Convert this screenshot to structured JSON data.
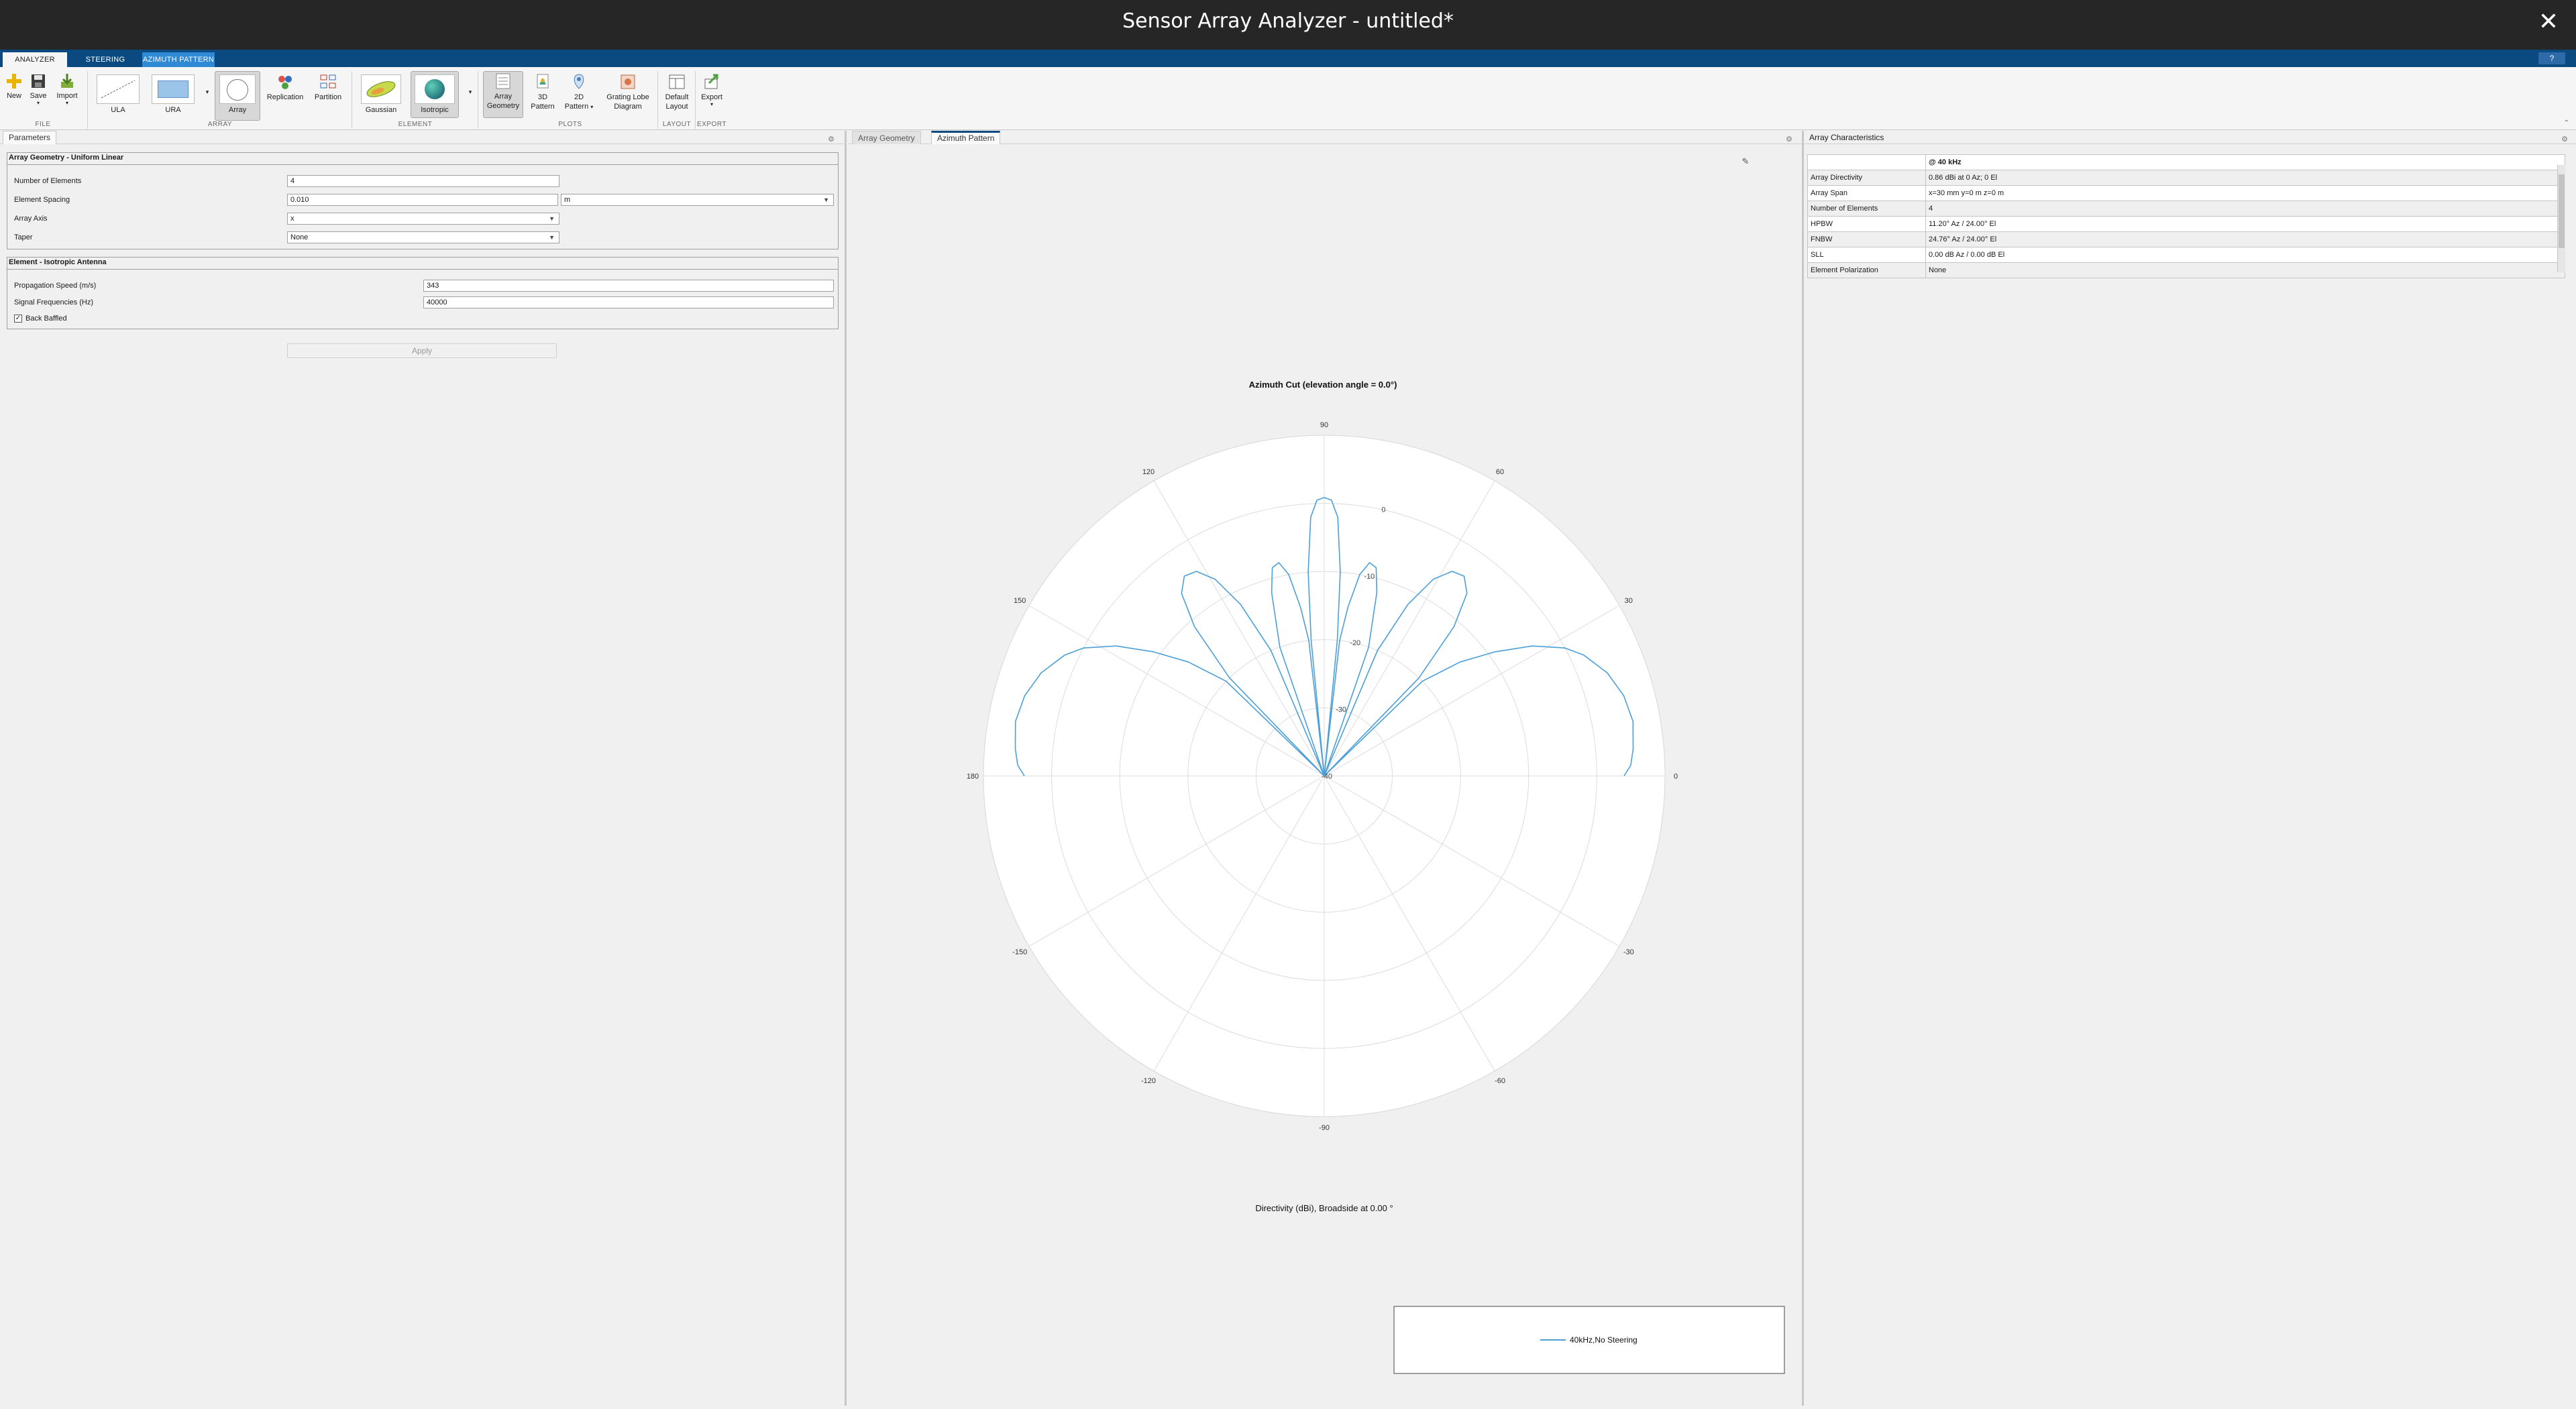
{
  "window": {
    "title": "Sensor Array Analyzer - untitled*",
    "close_glyph": "✕"
  },
  "ribbon_tabs": [
    {
      "label": "ANALYZER",
      "state": "active"
    },
    {
      "label": "STEERING",
      "state": "normal"
    },
    {
      "label": "AZIMUTH PATTERN",
      "state": "contextual"
    }
  ],
  "help_glyph": "?",
  "toolstrip": {
    "file": {
      "label": "FILE",
      "new": "New",
      "save": "Save",
      "import": "Import"
    },
    "array": {
      "label": "ARRAY",
      "ula": "ULA",
      "ura": "URA",
      "array": "Array",
      "replication": "Replication",
      "partition": "Partition"
    },
    "element": {
      "label": "ELEMENT",
      "gaussian": "Gaussian",
      "isotropic": "Isotropic"
    },
    "plots": {
      "label": "PLOTS",
      "array_geometry_1": "Array",
      "array_geometry_2": "Geometry",
      "pattern3d_1": "3D",
      "pattern3d_2": "Pattern",
      "pattern2d_1": "2D",
      "pattern2d_2": "Pattern",
      "grating_1": "Grating Lobe",
      "grating_2": "Diagram"
    },
    "layout": {
      "label": "LAYOUT",
      "default_1": "Default",
      "default_2": "Layout"
    },
    "export": {
      "label": "EXPORT",
      "export": "Export"
    }
  },
  "parameters": {
    "tab": "Parameters",
    "geometry": {
      "title": "Array Geometry - Uniform Linear",
      "num_elements_label": "Number of Elements",
      "num_elements": "4",
      "spacing_label": "Element Spacing",
      "spacing": "0.010",
      "spacing_unit": "m",
      "axis_label": "Array Axis",
      "axis": "x",
      "taper_label": "Taper",
      "taper": "None"
    },
    "element": {
      "title": "Element - Isotropic Antenna",
      "speed_label": "Propagation Speed (m/s)",
      "speed": "343",
      "freq_label": "Signal Frequencies (Hz)",
      "freq": "40000",
      "baffled_label": "Back Baffled",
      "baffled_checked": true
    },
    "apply": "Apply"
  },
  "plot_tabs": [
    "Array Geometry",
    "Azimuth Pattern"
  ],
  "chart_data": {
    "type": "polar-line",
    "title": "Azimuth Cut (elevation angle = 0.0°)",
    "subtitle": "Directivity (dBi), Broadside at 0.00 °",
    "angle_ticks": [
      "0",
      "30",
      "60",
      "90",
      "120",
      "150",
      "180",
      "-150",
      "-120",
      "-90",
      "-60",
      "-30"
    ],
    "radial_ticks": [
      "0",
      "-10",
      "-20",
      "-30",
      "-40"
    ],
    "rlim": [
      -40,
      0
    ],
    "legend": [
      "40kHz,No Steering"
    ],
    "series": [
      {
        "name": "40kHz,No Steering",
        "color": "#4c9fd8",
        "points": [
          [
            0,
            4
          ],
          [
            2,
            5
          ],
          [
            5,
            5.5
          ],
          [
            10,
            6
          ],
          [
            15,
            5.5
          ],
          [
            20,
            4.2
          ],
          [
            25,
            2.0
          ],
          [
            28,
            0
          ],
          [
            32,
            -4
          ],
          [
            36,
            -9
          ],
          [
            40,
            -14
          ],
          [
            44,
            -20
          ],
          [
            45,
            -40
          ],
          [
            46,
            -20
          ],
          [
            49,
            -11
          ],
          [
            52,
            -6
          ],
          [
            55,
            -4.2
          ],
          [
            58,
            -4.6
          ],
          [
            61,
            -7
          ],
          [
            64,
            -12
          ],
          [
            67,
            -20
          ],
          [
            69,
            -40
          ],
          [
            71,
            -20
          ],
          [
            74,
            -12
          ],
          [
            76,
            -8.5
          ],
          [
            78,
            -8
          ],
          [
            80,
            -10
          ],
          [
            82,
            -15
          ],
          [
            83.5,
            -20
          ],
          [
            84,
            -40
          ],
          [
            84.5,
            -20
          ],
          [
            85.5,
            -10
          ],
          [
            87,
            -2
          ],
          [
            88.5,
            0.5
          ],
          [
            90,
            0.86
          ],
          [
            91.5,
            0.5
          ],
          [
            93,
            -2
          ],
          [
            94.5,
            -10
          ],
          [
            95.5,
            -20
          ],
          [
            96,
            -40
          ],
          [
            96.5,
            -20
          ],
          [
            98,
            -15
          ],
          [
            100,
            -10
          ],
          [
            102,
            -8
          ],
          [
            104,
            -8.5
          ],
          [
            106,
            -12
          ],
          [
            109,
            -20
          ],
          [
            111,
            -40
          ],
          [
            113,
            -20
          ],
          [
            116,
            -12
          ],
          [
            119,
            -7
          ],
          [
            122,
            -4.6
          ],
          [
            125,
            -4.2
          ],
          [
            128,
            -6
          ],
          [
            131,
            -11
          ],
          [
            134,
            -20
          ],
          [
            135,
            -40
          ],
          [
            136,
            -20
          ],
          [
            140,
            -14
          ],
          [
            144,
            -9
          ],
          [
            148,
            -4
          ],
          [
            152,
            0
          ],
          [
            155,
            2.0
          ],
          [
            160,
            4.2
          ],
          [
            165,
            5.5
          ],
          [
            170,
            6
          ],
          [
            175,
            5.5
          ],
          [
            178,
            5
          ],
          [
            180,
            4
          ]
        ]
      }
    ]
  },
  "characteristics": {
    "title": "Array Characteristics",
    "column_header": "@ 40 kHz",
    "rows": [
      {
        "k": "Array Directivity",
        "v": "0.86 dBi at 0 Az; 0 El"
      },
      {
        "k": "Array Span",
        "v": "x=30 mm y=0 m z=0 m"
      },
      {
        "k": "Number of Elements",
        "v": "4"
      },
      {
        "k": "HPBW",
        "v": "11.20° Az / 24.00° El"
      },
      {
        "k": "FNBW",
        "v": "24.76° Az / 24.00° El"
      },
      {
        "k": "SLL",
        "v": "0.00 dB Az / 0.00 dB El"
      },
      {
        "k": "Element Polarization",
        "v": "None"
      }
    ]
  }
}
